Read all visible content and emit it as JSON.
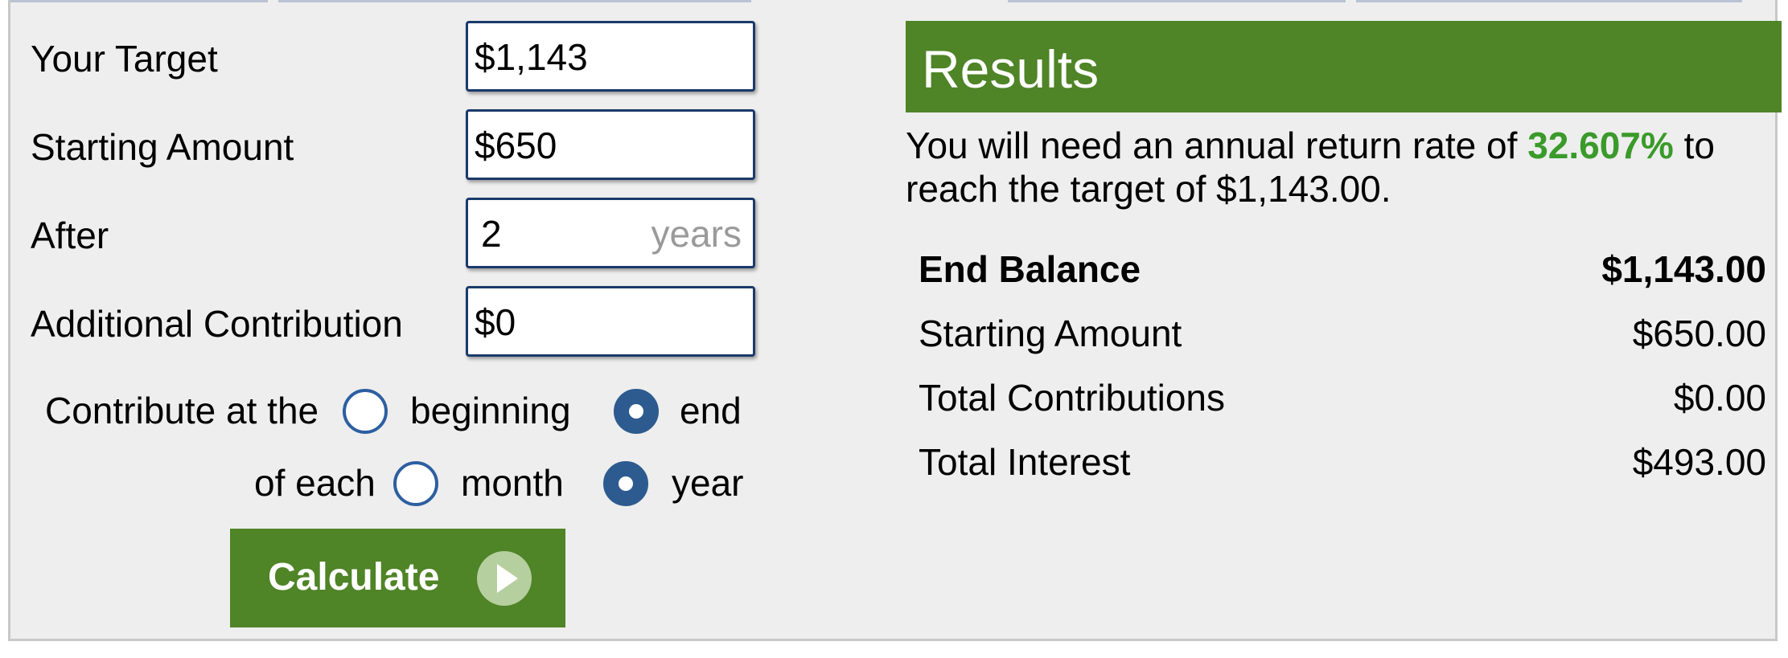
{
  "form": {
    "target": {
      "label": "Your Target",
      "value": "$1,143"
    },
    "starting": {
      "label": "Starting Amount",
      "value": "$650"
    },
    "after": {
      "label": "After",
      "value": "2",
      "unit": "years"
    },
    "contribution": {
      "label": "Additional Contribution",
      "value": "$0"
    },
    "contribute_timing": {
      "prefix": "Contribute at the",
      "options": [
        "beginning",
        "end"
      ],
      "selected": "end"
    },
    "contribute_period": {
      "prefix": "of each",
      "options": [
        "month",
        "year"
      ],
      "selected": "year"
    },
    "calculate_label": "Calculate"
  },
  "results": {
    "title": "Results",
    "summary_prefix": "You will need an annual return rate of",
    "rate": "32.607%",
    "summary_suffix": "to reach the target of $1,143.00.",
    "rows": [
      {
        "label": "End Balance",
        "value": "$1,143.00"
      },
      {
        "label": "Starting Amount",
        "value": "$650.00"
      },
      {
        "label": "Total Contributions",
        "value": "$0.00"
      },
      {
        "label": "Total Interest",
        "value": "$493.00"
      }
    ]
  },
  "colors": {
    "accent_green": "#4f8427",
    "rate_green": "#3a9a2a",
    "field_border": "#1a3a6b",
    "radio_blue": "#2d5b8f"
  }
}
